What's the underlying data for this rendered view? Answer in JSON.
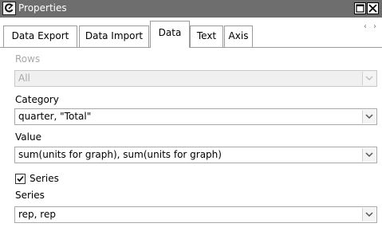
{
  "window": {
    "title": "Properties"
  },
  "tabs": [
    {
      "label": "Data Export",
      "active": false
    },
    {
      "label": "Data Import",
      "active": false
    },
    {
      "label": "Data",
      "active": true
    },
    {
      "label": "Text",
      "active": false
    },
    {
      "label": "Axis",
      "active": false
    }
  ],
  "tab_scroll": {
    "left": "‹",
    "right": "›"
  },
  "fields": {
    "rows": {
      "label": "Rows",
      "value": "All",
      "enabled": false
    },
    "category": {
      "label": "Category",
      "value": "quarter, \"Total\"",
      "enabled": true
    },
    "value": {
      "label": "Value",
      "value": "sum(units for graph), sum(units for graph)",
      "enabled": true
    },
    "series_checkbox": {
      "label": "Series",
      "checked": true
    },
    "series": {
      "label": "Series",
      "value": "rep, rep",
      "enabled": true
    }
  },
  "colors": {
    "titlebar": "#6e6e6e",
    "border": "#a9a9a9",
    "disabled_text": "#a8a8a8"
  },
  "icons": {
    "app": "app-icon",
    "restore": "restore-icon",
    "close": "close-icon",
    "dropdown": "chevron-down-icon",
    "check": "checkmark-icon"
  }
}
